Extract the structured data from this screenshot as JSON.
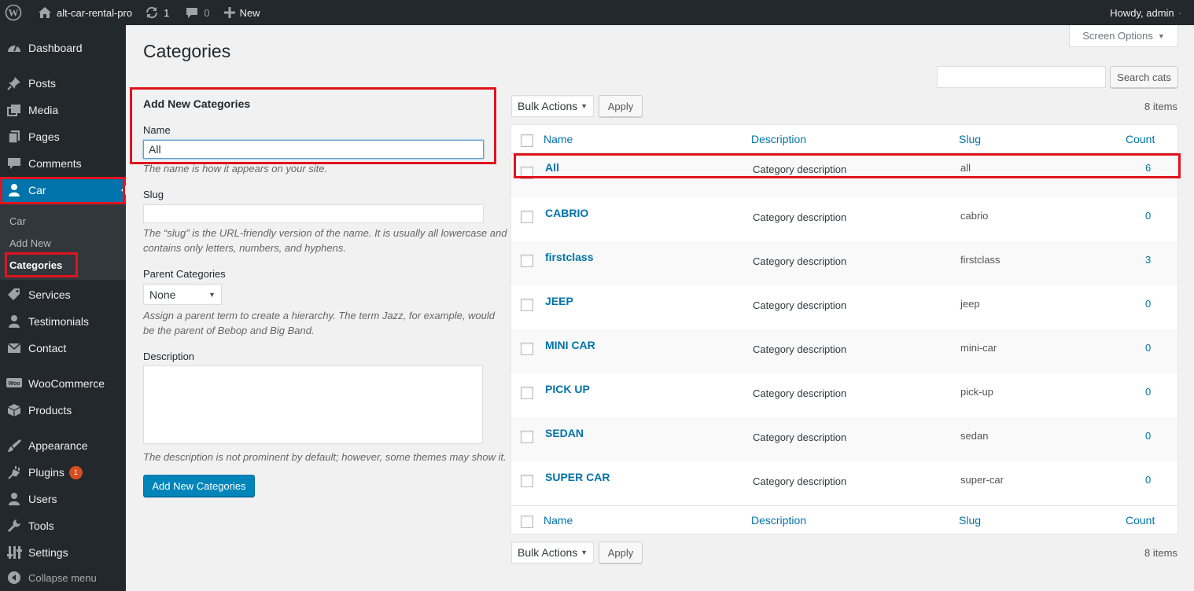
{
  "adminbar": {
    "site_name": "alt-car-rental-pro",
    "updates_count": "1",
    "comments_count": "0",
    "new_label": "New",
    "howdy": "Howdy, admin"
  },
  "sidebar": {
    "items": [
      {
        "label": "Dashboard",
        "icon": "dashboard-icon"
      },
      {
        "label": "Posts",
        "icon": "pin-icon"
      },
      {
        "label": "Media",
        "icon": "media-icon"
      },
      {
        "label": "Pages",
        "icon": "pages-icon"
      },
      {
        "label": "Comments",
        "icon": "comment-icon"
      },
      {
        "label": "Car",
        "icon": "user-icon"
      },
      {
        "label": "Services",
        "icon": "tag-icon"
      },
      {
        "label": "Testimonials",
        "icon": "user-icon"
      },
      {
        "label": "Contact",
        "icon": "envelope-icon"
      },
      {
        "label": "WooCommerce",
        "icon": "woo-icon"
      },
      {
        "label": "Products",
        "icon": "box-icon"
      },
      {
        "label": "Appearance",
        "icon": "brush-icon"
      },
      {
        "label": "Plugins",
        "icon": "plug-icon",
        "badge": "1"
      },
      {
        "label": "Users",
        "icon": "user-icon"
      },
      {
        "label": "Tools",
        "icon": "wrench-icon"
      },
      {
        "label": "Settings",
        "icon": "sliders-icon"
      }
    ],
    "car_submenu": [
      "Car",
      "Add New",
      "Categories"
    ],
    "collapse_label": "Collapse menu"
  },
  "screen_options": "Screen Options",
  "page_title": "Categories",
  "form": {
    "heading": "Add New Categories",
    "name_label": "Name",
    "name_value": "All",
    "name_help": "The name is how it appears on your site.",
    "slug_label": "Slug",
    "slug_value": "",
    "slug_help_1": "The “slug” is the URL-friendly version of the name. It is usually all lowercase and",
    "slug_help_2": "contains only letters, numbers, and hyphens.",
    "parent_label": "Parent Categories",
    "parent_value": "None",
    "parent_help_1": "Assign a parent term to create a hierarchy. The term Jazz, for example, would",
    "parent_help_2": "be the parent of Bebop and Big Band.",
    "description_label": "Description",
    "description_help": "The description is not prominent by default; however, some themes may show it.",
    "submit_label": "Add New Categories"
  },
  "search": {
    "button_label": "Search cats",
    "value": ""
  },
  "bulk": {
    "select_label": "Bulk Actions",
    "apply_label": "Apply",
    "items_count": "8 items"
  },
  "table": {
    "columns": {
      "name": "Name",
      "description": "Description",
      "slug": "Slug",
      "count": "Count"
    },
    "rows": [
      {
        "name": "All",
        "description": "Category description",
        "slug": "all",
        "count": "6"
      },
      {
        "name": "CABRIO",
        "description": "Category description",
        "slug": "cabrio",
        "count": "0"
      },
      {
        "name": "firstclass",
        "description": "Category description",
        "slug": "firstclass",
        "count": "3"
      },
      {
        "name": "JEEP",
        "description": "Category description",
        "slug": "jeep",
        "count": "0"
      },
      {
        "name": "MINI CAR",
        "description": "Category description",
        "slug": "mini-car",
        "count": "0"
      },
      {
        "name": "PICK UP",
        "description": "Category description",
        "slug": "pick-up",
        "count": "0"
      },
      {
        "name": "SEDAN",
        "description": "Category description",
        "slug": "sedan",
        "count": "0"
      },
      {
        "name": "SUPER CAR",
        "description": "Category description",
        "slug": "super-car",
        "count": "0"
      }
    ]
  },
  "colors": {
    "accent": "#0073aa",
    "primary_button": "#0085ba",
    "highlight": "#e0141e",
    "sidebar": "#23282d"
  }
}
